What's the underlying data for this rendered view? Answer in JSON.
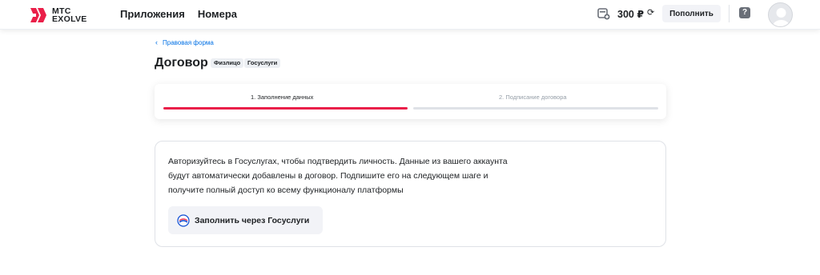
{
  "header": {
    "logo_text_line1": "МТС",
    "logo_text_line2": "EXOLVE",
    "nav": [
      "Приложения",
      "Номера"
    ],
    "balance": "300 ₽",
    "topup_label": "Пополнить",
    "help_glyph": "?"
  },
  "breadcrumb": {
    "label": "Правовая форма"
  },
  "page": {
    "title": "Договор",
    "badges": [
      "Физлицо",
      "Госуслуги"
    ]
  },
  "stepper": {
    "steps": [
      "1. Заполнение данных",
      "2. Подписание договора"
    ],
    "active_step": 1
  },
  "info": {
    "text_lines": [
      "Авторизуйтесь в Госуслугах, чтобы подтвердить личность. Данные из вашего аккаунта",
      "будут автоматически добавлены в договор. Подпишите его на следующем шаге и",
      "получите полный доступ ко всему функционалу платформы"
    ],
    "button_label": "Заполнить через Госуслуги"
  },
  "colors": {
    "accent": "#ea1f49",
    "link": "#0070e5",
    "muted": "#969fa8",
    "button_bg": "#f2f3f7"
  },
  "icons": [
    "logo-icon",
    "wallet-icon",
    "refresh-icon",
    "help-icon",
    "avatar",
    "chevron-left-icon",
    "gosuslugi-icon"
  ]
}
